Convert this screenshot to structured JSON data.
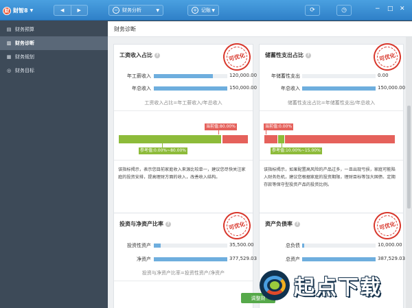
{
  "app": {
    "title": "财智8",
    "logo_char": "财",
    "nav_back": "◀",
    "nav_forward": "▶",
    "module_select": "财务分析",
    "add_label": "记账",
    "refresh_icon": "⟳",
    "clock_icon": "◷"
  },
  "window_controls": {
    "minimize": "−",
    "maximize": "□",
    "close": "✕"
  },
  "sidebar": {
    "items": [
      {
        "label": "财务预算",
        "icon": "budget-icon",
        "active": false
      },
      {
        "label": "财务诊断",
        "icon": "diagnosis-icon",
        "active": true
      },
      {
        "label": "财务规划",
        "icon": "plan-icon",
        "active": false
      },
      {
        "label": "财务目标",
        "icon": "target-icon",
        "active": false
      }
    ]
  },
  "main": {
    "title": "财务诊断"
  },
  "cards": {
    "wage": {
      "title": "工资收入占比",
      "stamp": "可优化",
      "rows": [
        {
          "label": "年工薪收入",
          "value": "120,000.00",
          "fraction": 0.8
        },
        {
          "label": "年总收入",
          "value": "150,000.00",
          "fraction": 1.0
        }
      ],
      "formula": "工资收入占比=年工薪收入/年总收入",
      "current_label": "当前值:80.00%",
      "reference_label": "参考值:0.00%~80.00%",
      "current_value": 0.8,
      "ref_range": [
        0.0,
        0.8
      ],
      "description": "该指标揭示，表示您目前家庭收入来源比较单一，建议您尽快关注家庭的投资安排，提高理财方面的收入，改善收入结构。"
    },
    "savings": {
      "title": "储蓄性支出占比",
      "stamp": "可优化",
      "rows": [
        {
          "label": "年储蓄性支出",
          "value": "0.00",
          "fraction": 0.0
        },
        {
          "label": "年总收入",
          "value": "150,000.00",
          "fraction": 1.0
        }
      ],
      "formula": "储蓄性支出占比=年储蓄性支出/年总收入",
      "current_label": "当前值:0.00%",
      "reference_label": "参考值:10.00%~15.00%",
      "current_value": 0.0,
      "ref_range": [
        0.1,
        0.15
      ],
      "description": "该指标揭示，如果配置高风险的产品过多，一旦出现亏损，家庭可能陷入财务危机，建议您根据家庭的投资期限，理财目标等加大国债、定期存款等保守型投资产品的投资比例。"
    },
    "investment": {
      "title": "投资与净资产比率",
      "stamp": "可优化",
      "rows": [
        {
          "label": "投资性资产",
          "value": "35,500.00",
          "fraction": 0.09
        },
        {
          "label": "净资产",
          "value": "377,529.03",
          "fraction": 1.0
        }
      ],
      "formula": "投资与净资产比率=投资性资产/净资产"
    },
    "debt": {
      "title": "资产负债率",
      "stamp": "可优化",
      "rows": [
        {
          "label": "总负债",
          "value": "10,000.00",
          "fraction": 0.03
        },
        {
          "label": "总资产",
          "value": "387,529.03",
          "fraction": 1.0
        }
      ]
    }
  },
  "float_button": "调整财",
  "watermark": "起点下载",
  "colors": {
    "accent": "#3a8bd4",
    "bar": "#6eaede",
    "current": "#e5615b",
    "reference": "#8dbb3a"
  }
}
